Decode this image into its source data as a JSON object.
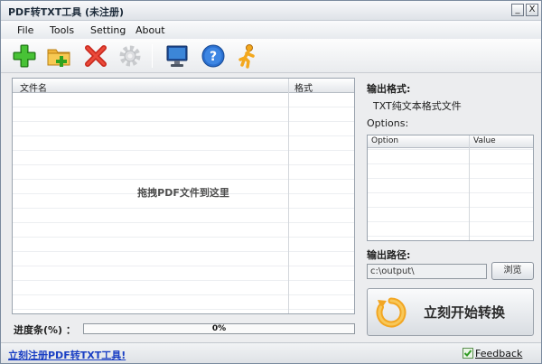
{
  "window": {
    "title": "PDF转TXT工具 (未注册)",
    "minimize_glyph": "_",
    "close_glyph": "X"
  },
  "menu": [
    "File",
    "Tools",
    "Setting",
    "About"
  ],
  "toolbar": {
    "icons": [
      "add-icon",
      "add-folder-icon",
      "delete-icon",
      "settings-gear-icon",
      "monitor-icon",
      "help-icon",
      "runner-icon"
    ]
  },
  "file_list": {
    "columns": [
      "文件名",
      "格式"
    ],
    "drop_hint": "拖拽PDF文件到这里"
  },
  "progress": {
    "label": "进度条(%) ：",
    "value_text": "0%",
    "value": 0
  },
  "output": {
    "format_label": "输出格式:",
    "format_value": "TXT纯文本格式文件",
    "options_label": "Options:",
    "options_columns": [
      "Option",
      "Value"
    ],
    "path_label": "输出路径:",
    "path_value": "c:\\output\\",
    "browse_label": "浏览",
    "convert_label": "立刻开始转换"
  },
  "status": {
    "register_link": "立刻注册PDF转TXT工具!",
    "feedback": "Feedback"
  },
  "colors": {
    "link": "#1a3fc4",
    "convert_icon": "#f2a623"
  }
}
